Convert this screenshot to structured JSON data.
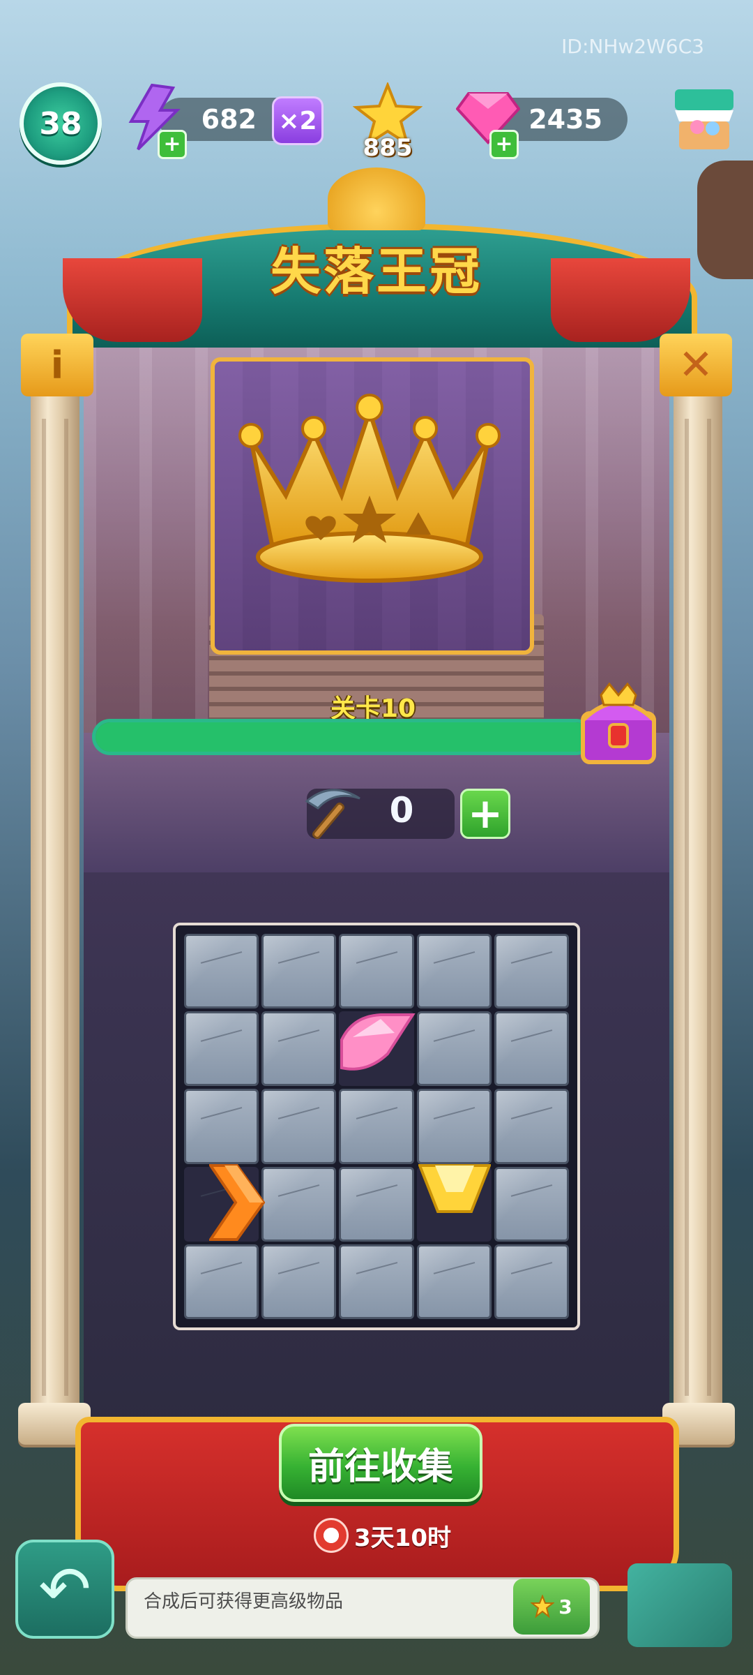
{
  "header": {
    "user_id": "ID:NHw2W6C3",
    "player_level": "38",
    "energy": "682",
    "energy_multiplier": "×2",
    "stars": "885",
    "gems": "2435"
  },
  "event": {
    "title": "失落王冠",
    "level_label": "关卡10",
    "progress_fraction": 1.0
  },
  "pickaxe": {
    "count": "0"
  },
  "grid": {
    "rows": 5,
    "cols": 5,
    "open_cells": [
      [
        1,
        2
      ],
      [
        3,
        0
      ],
      [
        3,
        3
      ]
    ],
    "gems": [
      {
        "name": "pink-gem",
        "row": 1,
        "col": 2
      },
      {
        "name": "orange-gem",
        "row": 3,
        "col": 0
      },
      {
        "name": "yellow-gem",
        "row": 3,
        "col": 3
      }
    ]
  },
  "footer": {
    "go_button_label": "前往收集",
    "timer_text": "3天10时",
    "hint_text": "合成后可获得更高级物品",
    "hint_star_count": "3"
  },
  "colors": {
    "accent_green": "#37b233",
    "banner_red": "#d6302c",
    "gold": "#f2b630",
    "arch_teal": "#167a70"
  }
}
